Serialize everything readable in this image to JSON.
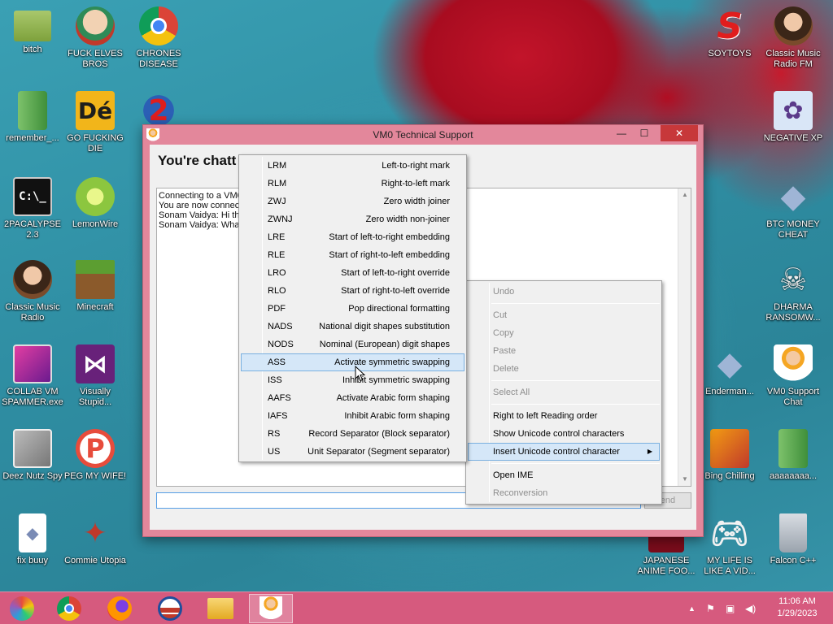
{
  "desktop": {
    "icons": [
      {
        "label": "bitch",
        "icon": "folder-icon"
      },
      {
        "label": "FUCK ELVES BROS",
        "icon": "elf-icon"
      },
      {
        "label": "CHRONES DISEASE",
        "icon": "chrome-icon"
      },
      {
        "label": "SOYTOYS",
        "icon": "s-logo-icon"
      },
      {
        "label": "Classic Music Radio FM",
        "icon": "portrait-icon"
      },
      {
        "label": "remember_...",
        "icon": "zip-file-icon"
      },
      {
        "label": "GO FUCKING DIE",
        "icon": "de-logo-icon"
      },
      {
        "label": "NEGATIVE XP",
        "icon": "bunny-icon"
      },
      {
        "label": "2PACALYPSE 2.3",
        "icon": "cmd-icon"
      },
      {
        "label": "LemonWire",
        "icon": "lime-icon"
      },
      {
        "label": "BTC MONEY CHEAT",
        "icon": "diamond-icon"
      },
      {
        "label": "Classic Music Radio",
        "icon": "portrait-icon"
      },
      {
        "label": "Minecraft",
        "icon": "grass-block-icon"
      },
      {
        "label": "DHARMA RANSOMW...",
        "icon": "skull-icon"
      },
      {
        "label": "COLLAB VM SPAMMER.exe",
        "icon": "monitor-icon"
      },
      {
        "label": "Visually Stupid...",
        "icon": "visual-studio-icon"
      },
      {
        "label": "Enderman...",
        "icon": "diamond-icon"
      },
      {
        "label": "VM0 Support Chat",
        "icon": "support-agent-icon"
      },
      {
        "label": "Deez Nutz Spy",
        "icon": "windows-icon"
      },
      {
        "label": "PEG MY WIFE!",
        "icon": "p-logo-icon"
      },
      {
        "label": "Bing Chilling",
        "icon": "book-icon"
      },
      {
        "label": "aaaaaaaa...",
        "icon": "zip-file-icon"
      },
      {
        "label": "fix buuy",
        "icon": "file-icon"
      },
      {
        "label": "Commie Utopia",
        "icon": "emblem-icon"
      },
      {
        "label": "JAPANESE ANIME FOO...",
        "icon": "video-icon"
      },
      {
        "label": "MY LIFE IS LIKE A VID...",
        "icon": "gamepad-icon"
      },
      {
        "label": "Falcon C++",
        "icon": "trash-icon"
      }
    ]
  },
  "window": {
    "title": "VM0 Technical Support",
    "heading": "You're chatt",
    "chat_lines": [
      "Connecting to a VM0",
      "You are now connect",
      "Sonam Vaidya: Hi the",
      "Sonam Vaidya: What"
    ],
    "send_label": "end",
    "controls": {
      "minimize": "—",
      "maximize": "☐",
      "close": "✕"
    }
  },
  "context_menu": {
    "undo": "Undo",
    "cut": "Cut",
    "copy": "Copy",
    "paste": "Paste",
    "delete": "Delete",
    "select_all": "Select All",
    "rtl": "Right to left Reading order",
    "show_unicode": "Show Unicode control characters",
    "insert_unicode": "Insert Unicode control character",
    "open_ime": "Open IME",
    "reconversion": "Reconversion"
  },
  "unicode_submenu": {
    "items": [
      {
        "code": "LRM",
        "desc": "Left-to-right mark"
      },
      {
        "code": "RLM",
        "desc": "Right-to-left mark"
      },
      {
        "code": "ZWJ",
        "desc": "Zero width joiner"
      },
      {
        "code": "ZWNJ",
        "desc": "Zero width non-joiner"
      },
      {
        "code": "LRE",
        "desc": "Start of left-to-right embedding"
      },
      {
        "code": "RLE",
        "desc": "Start of right-to-left embedding"
      },
      {
        "code": "LRO",
        "desc": "Start of left-to-right override"
      },
      {
        "code": "RLO",
        "desc": "Start of right-to-left override"
      },
      {
        "code": "PDF",
        "desc": "Pop directional formatting"
      },
      {
        "code": "NADS",
        "desc": "National digit shapes substitution"
      },
      {
        "code": "NODS",
        "desc": "Nominal (European) digit shapes"
      },
      {
        "code": "ASS",
        "desc": "Activate symmetric swapping"
      },
      {
        "code": "ISS",
        "desc": "Inhibit symmetric swapping"
      },
      {
        "code": "AAFS",
        "desc": "Activate Arabic form shaping"
      },
      {
        "code": "IAFS",
        "desc": "Inhibit Arabic form shaping"
      },
      {
        "code": "RS",
        "desc": "Record Separator (Block separator)"
      },
      {
        "code": "US",
        "desc": "Unit Separator (Segment separator)"
      }
    ]
  },
  "taskbar": {
    "apps": [
      "colorful-app-icon",
      "chrome-icon",
      "firefox-icon",
      "obama-logo-icon",
      "file-explorer-icon",
      "support-agent-icon"
    ],
    "time": "11:06 AM",
    "date": "1/29/2023"
  }
}
